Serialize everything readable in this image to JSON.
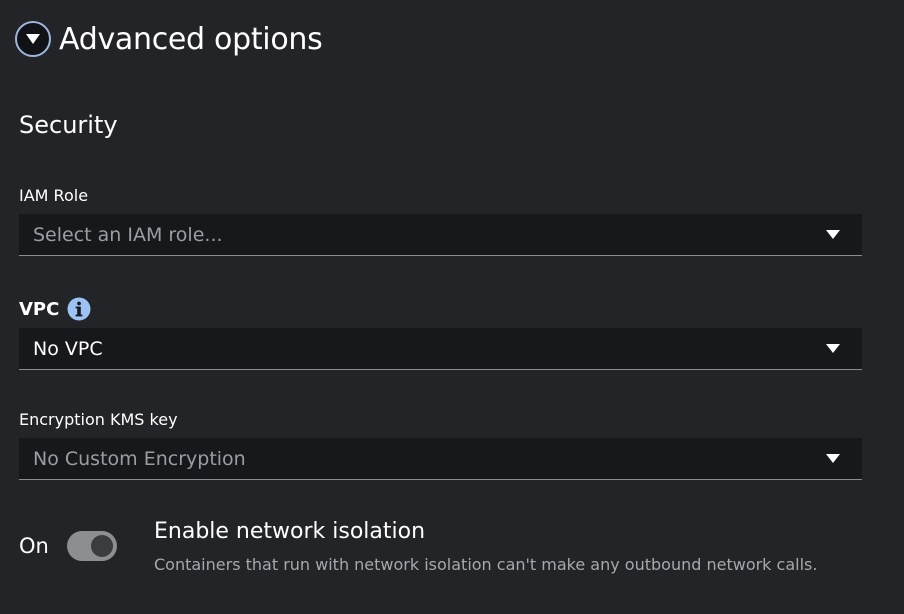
{
  "header": {
    "title": "Advanced options"
  },
  "security": {
    "title": "Security",
    "iam_role": {
      "label": "IAM Role",
      "placeholder": "Select an IAM role..."
    },
    "vpc": {
      "label": "VPC",
      "value": "No VPC"
    },
    "kms": {
      "label": "Encryption KMS key",
      "placeholder": "No Custom Encryption"
    }
  },
  "network_isolation": {
    "state_label": "On",
    "title": "Enable network isolation",
    "description": "Containers that run with network isolation can't make any outbound network calls."
  },
  "icons": {
    "expand": "triangle-down-icon",
    "info": "info-icon",
    "caret": "caret-down-icon"
  }
}
